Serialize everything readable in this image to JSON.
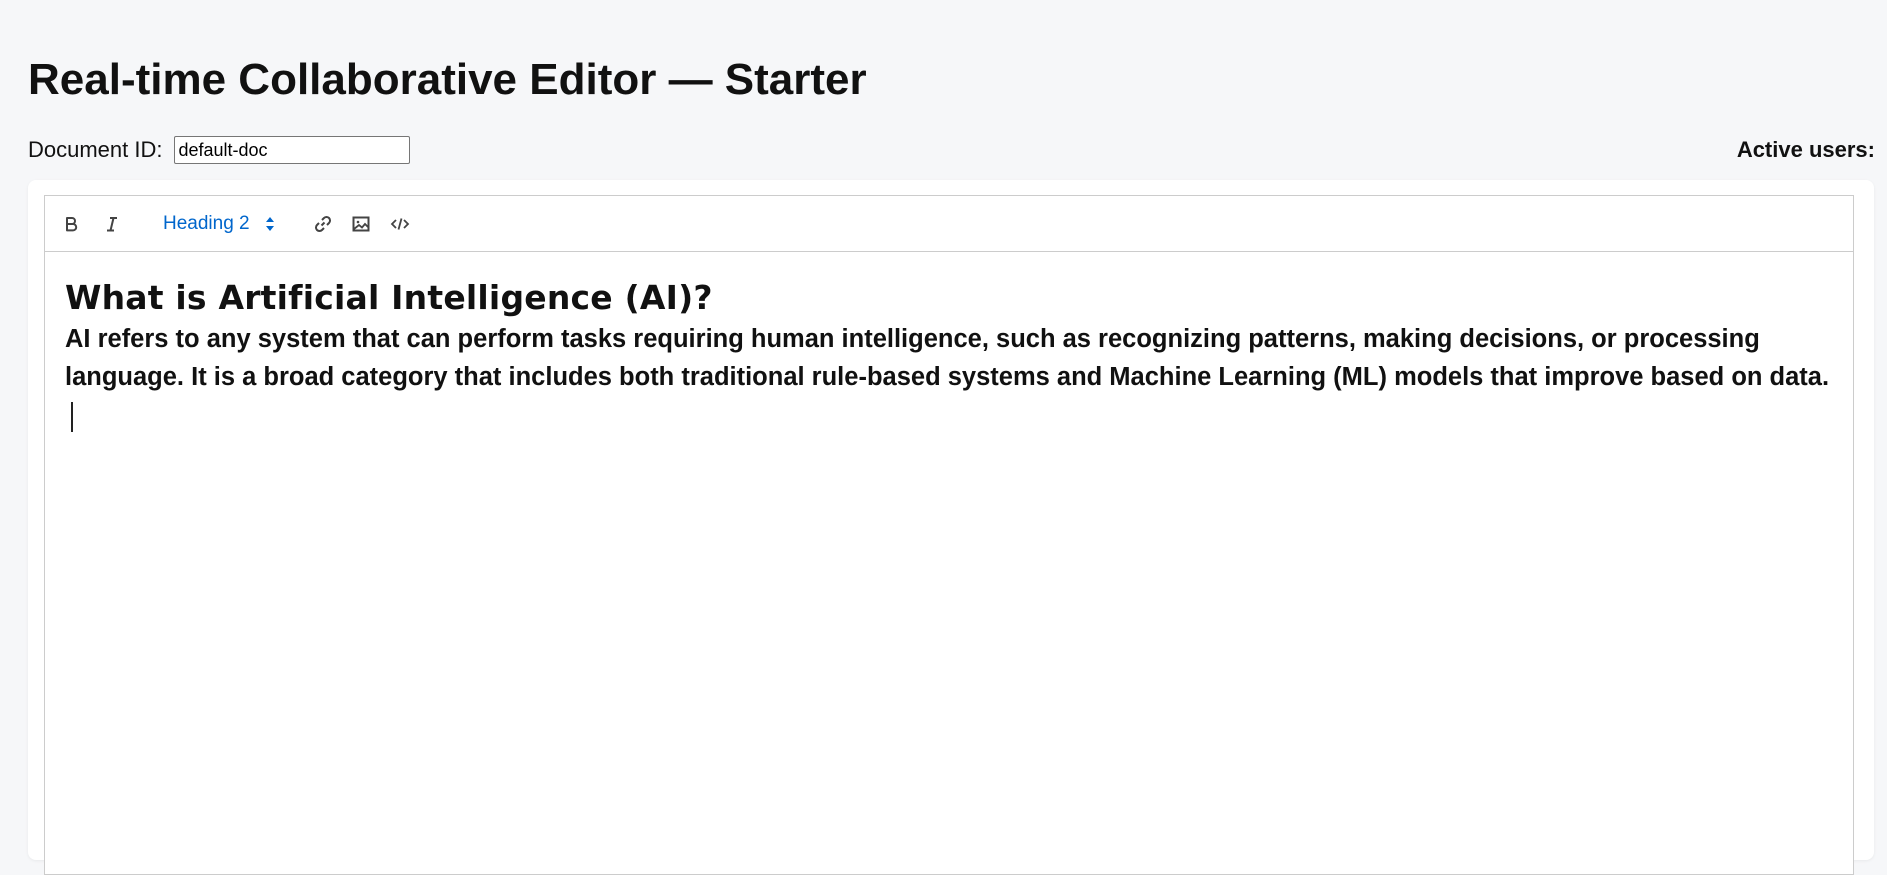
{
  "page": {
    "title": "Real-time Collaborative Editor — Starter"
  },
  "doc_row": {
    "label": "Document ID:",
    "input_value": "default-doc",
    "active_users_label": "Active users:"
  },
  "toolbar": {
    "bold_icon": "bold-icon",
    "italic_icon": "italic-icon",
    "header_select_value": "Heading 2",
    "header_select_icon": "select-arrows-icon",
    "link_icon": "link-icon",
    "image_icon": "image-icon",
    "code_icon": "code-icon",
    "accent_color": "#0066cc",
    "icon_color": "#444444"
  },
  "document": {
    "heading": "What is Artificial Intelligence (AI)?",
    "paragraph": "AI refers to any system that can perform tasks requiring human intelligence, such as recognizing patterns, making decisions, or processing language. It is a broad category that includes both traditional rule-based systems and Machine Learning (ML) models that improve based on data."
  }
}
